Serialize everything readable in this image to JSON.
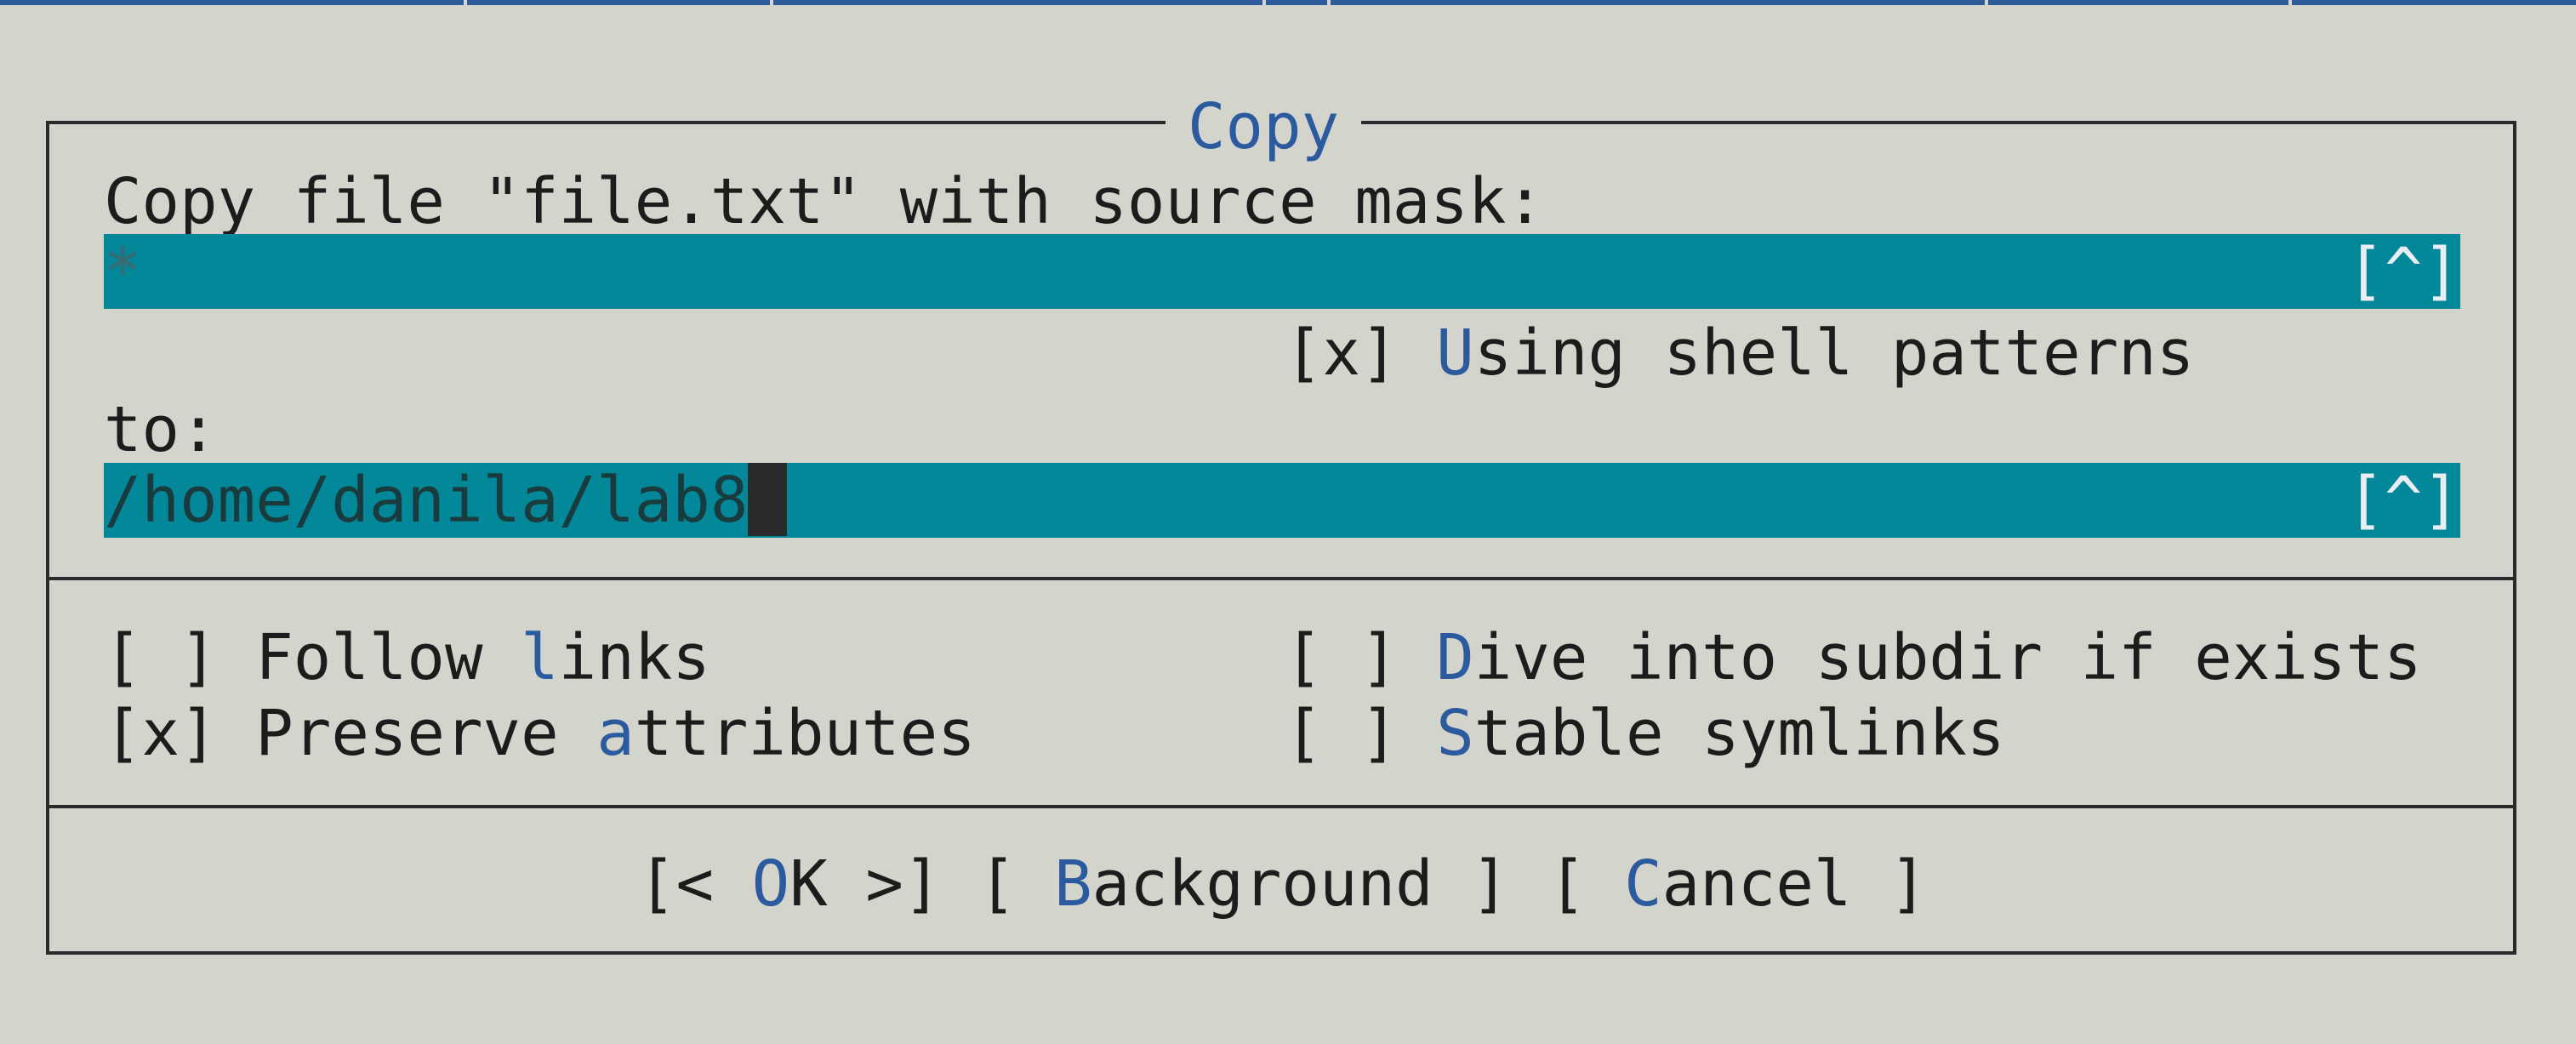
{
  "dialog": {
    "title": "Copy",
    "source_label": "Copy file \"file.txt\" with source mask:",
    "source_value": "*",
    "history_button": "[^]",
    "shell_patterns": {
      "box": "[x]",
      "label_hot": "U",
      "label_rest": "sing shell patterns"
    },
    "to_label": "to:",
    "dest_value": "/home/danila/lab8",
    "options": {
      "follow_links": {
        "box": "[ ]",
        "pre": "Follow ",
        "hot": "l",
        "post": "inks"
      },
      "preserve_attributes": {
        "box": "[x]",
        "pre": "Preserve ",
        "hot": "a",
        "post": "ttributes"
      },
      "dive_into_subdir": {
        "box": "[ ]",
        "pre": "",
        "hot": "D",
        "post": "ive into subdir if exists"
      },
      "stable_symlinks": {
        "box": "[ ]",
        "pre": "",
        "hot": "S",
        "post": "table symlinks"
      }
    },
    "buttons": {
      "ok": {
        "open": "[< ",
        "hot": "O",
        "rest": "K",
        "close": " >]"
      },
      "background": {
        "open": "[ ",
        "hot": "B",
        "rest": "ackground",
        "close": " ]"
      },
      "cancel": {
        "open": "[ ",
        "hot": "C",
        "rest": "ancel",
        "close": " ]"
      }
    }
  },
  "colors": {
    "accent": "#2b5a9e",
    "input_bg": "#028898",
    "dialog_bg": "#d3d5cd"
  }
}
